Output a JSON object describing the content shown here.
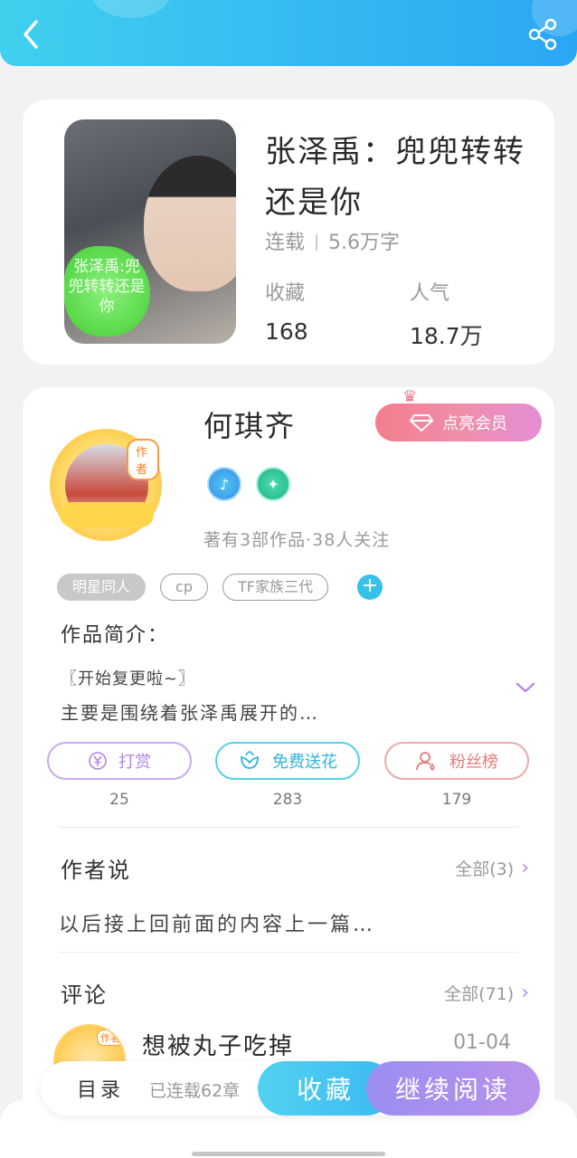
{
  "book": {
    "title": "张泽禹：兜兜转转还是你",
    "cover_text": "张泽禹:兜兜转转还是你",
    "status": "连载",
    "word_count": "5.6万字",
    "stats": [
      {
        "label": "收藏",
        "value": "168"
      },
      {
        "label": "人气",
        "value": "18.7万"
      }
    ]
  },
  "author": {
    "name": "何琪齐",
    "badge": "作者",
    "vip_label": "点亮会员",
    "meta": "著有3部作品·38人关注",
    "badges": [
      "music-badge-icon",
      "handshake-badge-icon"
    ]
  },
  "tags": [
    "明星同人",
    "cp",
    "TF家族三代"
  ],
  "intro": {
    "label": "作品简介：",
    "line1": "〖开始复更啦~〗",
    "line2": "主要是围绕着张泽禹展开的…"
  },
  "actions": [
    {
      "label": "打赏",
      "count": "25",
      "icon": "yen-icon"
    },
    {
      "label": "免费送花",
      "count": "283",
      "icon": "flower-icon"
    },
    {
      "label": "粉丝榜",
      "count": "179",
      "icon": "fans-icon"
    }
  ],
  "author_say": {
    "title": "作者说",
    "all": "全部(3)",
    "content": "以后接上回前面的内容上一篇…"
  },
  "comments": {
    "title": "评论",
    "all": "全部(71)",
    "first": {
      "name": "想被丸子吃掉",
      "date": "01-04",
      "badge": "作者"
    }
  },
  "bottom_bar": {
    "toc": "目录",
    "chapters": "已连载62章",
    "favorite": "收藏",
    "continue": "继续阅读"
  },
  "colors": {
    "header": "#33b7f2",
    "accent_blue": "#3bb9f2",
    "accent_purple": "#b992ec",
    "vip_pink": "#f47d8e"
  }
}
